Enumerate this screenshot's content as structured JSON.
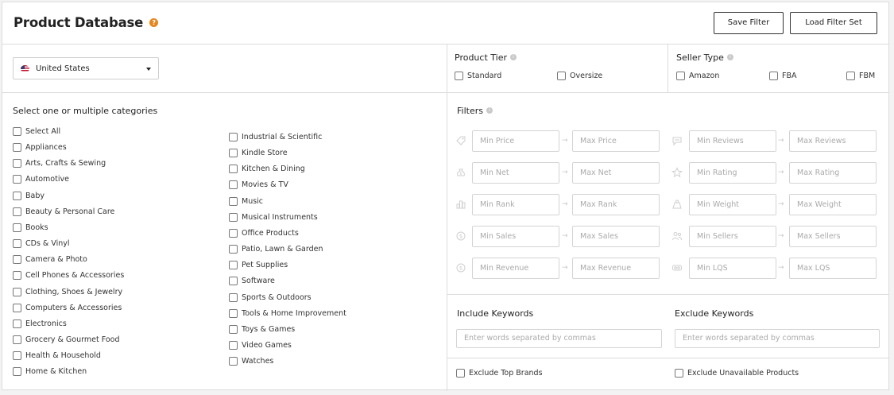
{
  "header": {
    "title": "Product Database",
    "help_badge": "?",
    "save_filter_label": "Save Filter",
    "load_filter_set_label": "Load Filter Set"
  },
  "marketplace": {
    "selected": "United States",
    "flag_icon": "us-flag-icon"
  },
  "product_tier": {
    "title": "Product Tier",
    "options": [
      "Standard",
      "Oversize"
    ]
  },
  "seller_type": {
    "title": "Seller Type",
    "options": [
      "Amazon",
      "FBA",
      "FBM"
    ]
  },
  "categories": {
    "title": "Select one or multiple categories",
    "left": [
      "Select All",
      "Appliances",
      "Arts, Crafts & Sewing",
      "Automotive",
      "Baby",
      "Beauty & Personal Care",
      "Books",
      "CDs & Vinyl",
      "Camera & Photo",
      "Cell Phones & Accessories",
      "Clothing, Shoes & Jewelry",
      "Computers & Accessories",
      "Electronics",
      "Grocery & Gourmet Food",
      "Health & Household",
      "Home & Kitchen"
    ],
    "right": [
      "Industrial & Scientific",
      "Kindle Store",
      "Kitchen & Dining",
      "Movies & TV",
      "Music",
      "Musical Instruments",
      "Office Products",
      "Patio, Lawn & Garden",
      "Pet Supplies",
      "Software",
      "Sports & Outdoors",
      "Tools & Home Improvement",
      "Toys & Games",
      "Video Games",
      "Watches"
    ]
  },
  "filters": {
    "title": "Filters",
    "left": [
      {
        "icon": "tag-icon",
        "min": "Min Price",
        "max": "Max Price"
      },
      {
        "icon": "money-bag-icon",
        "min": "Min Net",
        "max": "Max Net"
      },
      {
        "icon": "bar-chart-icon",
        "min": "Min Rank",
        "max": "Max Rank"
      },
      {
        "icon": "dollar-coin-icon",
        "min": "Min Sales",
        "max": "Max Sales"
      },
      {
        "icon": "dollar-circle-icon",
        "min": "Min Revenue",
        "max": "Max Revenue"
      }
    ],
    "right": [
      {
        "icon": "review-bubble-icon",
        "min": "Min Reviews",
        "max": "Max Reviews"
      },
      {
        "icon": "star-icon",
        "min": "Min Rating",
        "max": "Max Rating"
      },
      {
        "icon": "weight-icon",
        "min": "Min Weight",
        "max": "Max Weight"
      },
      {
        "icon": "users-icon",
        "min": "Min Sellers",
        "max": "Max Sellers"
      },
      {
        "icon": "lqs-icon",
        "min": "Min LQS",
        "max": "Max LQS"
      }
    ],
    "arrow_glyph": "→"
  },
  "keywords": {
    "include_title": "Include Keywords",
    "exclude_title": "Exclude Keywords",
    "include_placeholder": "Enter words separated by commas",
    "exclude_placeholder": "Enter words separated by commas",
    "exclude_top_brands": "Exclude Top Brands",
    "exclude_unavailable": "Exclude Unavailable Products"
  },
  "colors": {
    "accent_badge": "#e5861f",
    "border": "#dcdcdc",
    "placeholder": "#aaaaaa"
  }
}
